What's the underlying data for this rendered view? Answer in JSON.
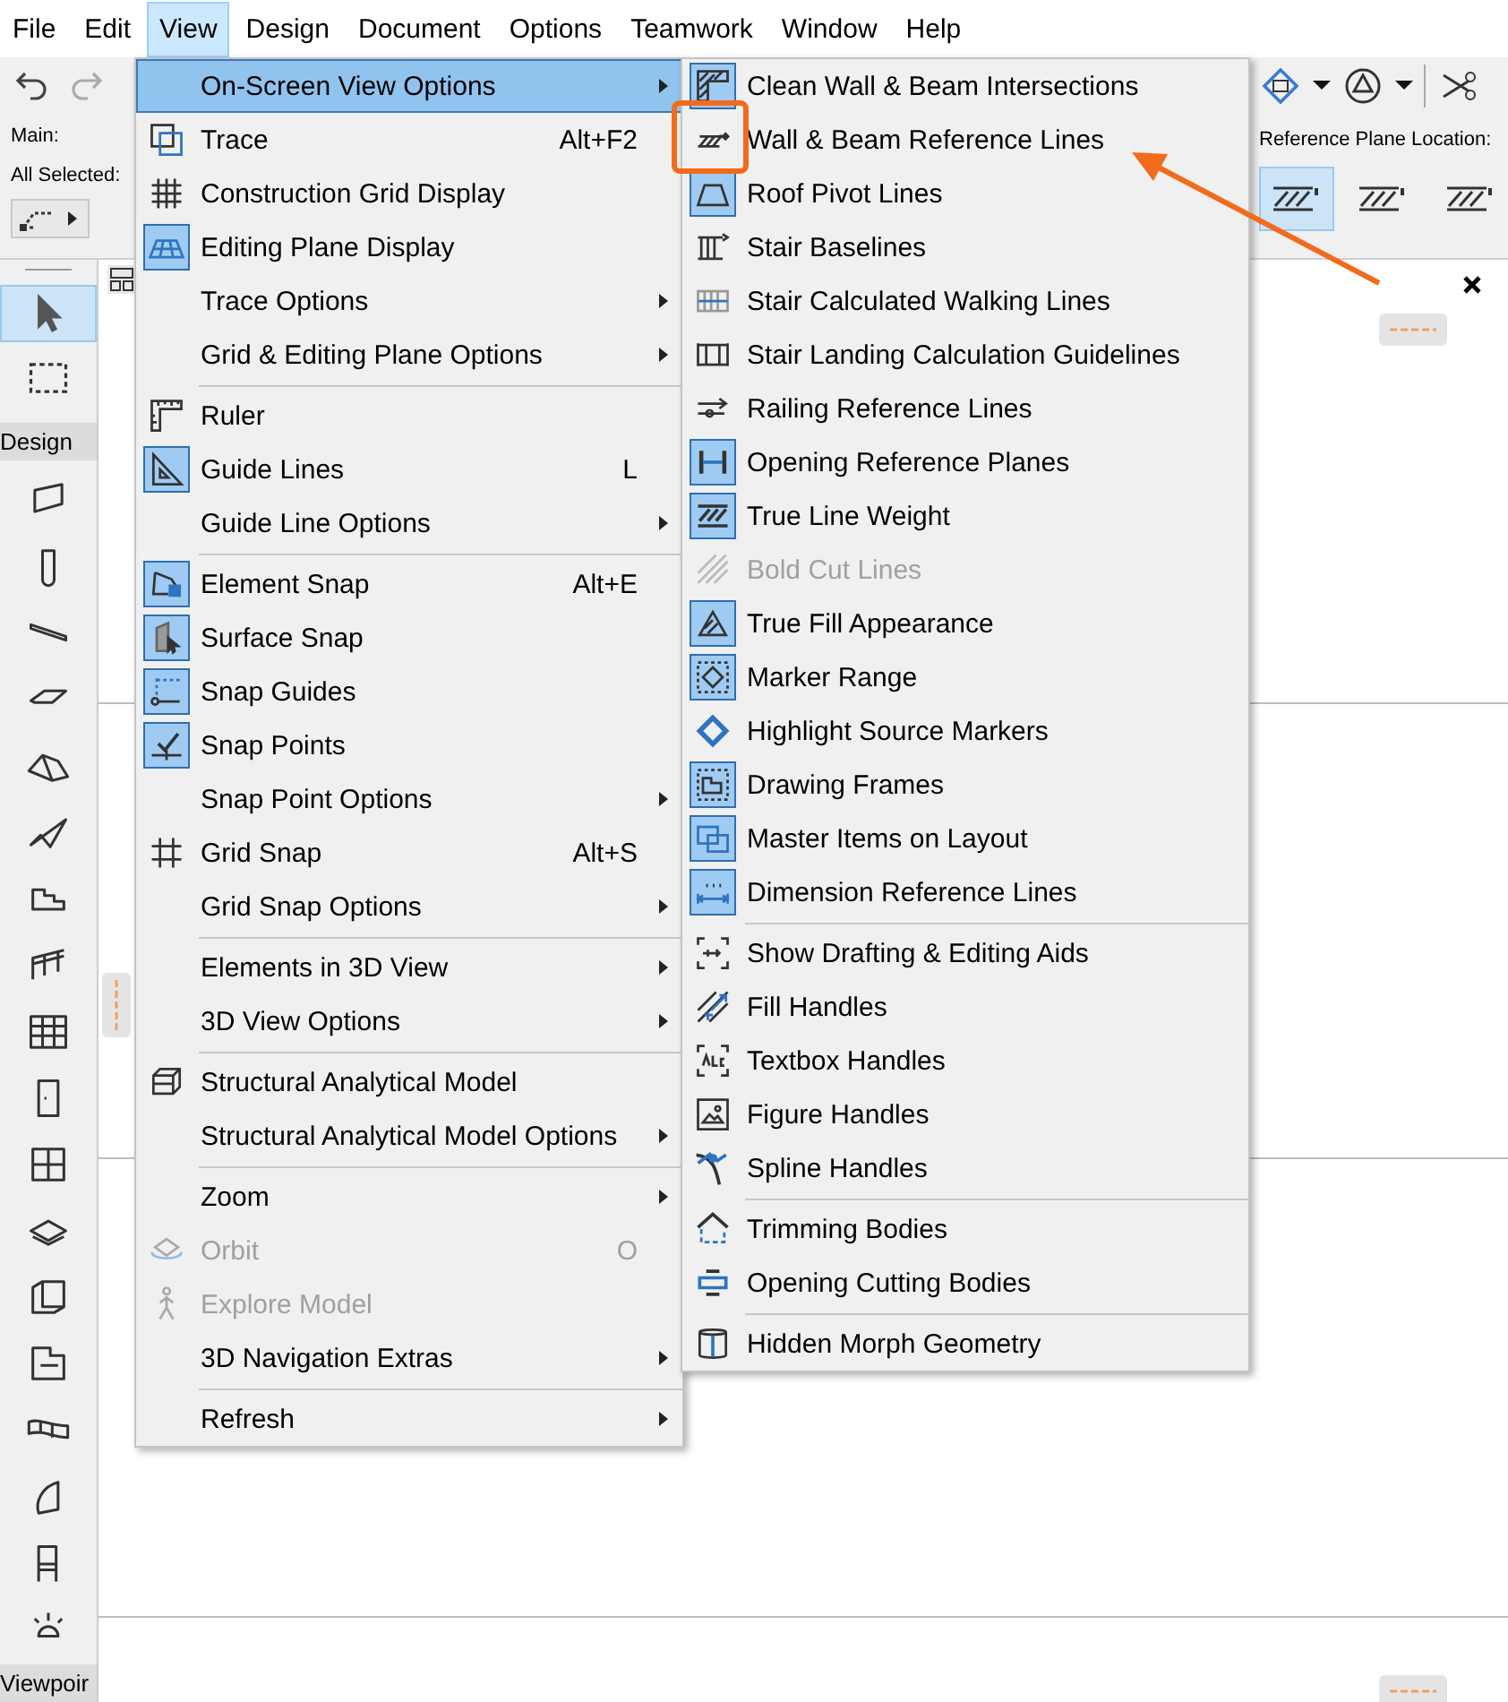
{
  "menubar": [
    {
      "label": "File",
      "selected": false
    },
    {
      "label": "Edit",
      "selected": false
    },
    {
      "label": "View",
      "selected": true
    },
    {
      "label": "Design",
      "selected": false
    },
    {
      "label": "Document",
      "selected": false
    },
    {
      "label": "Options",
      "selected": false
    },
    {
      "label": "Teamwork",
      "selected": false
    },
    {
      "label": "Window",
      "selected": false
    },
    {
      "label": "Help",
      "selected": false
    }
  ],
  "toolbar": {
    "main_label": "Main:",
    "selection_label": "All Selected:",
    "reference_plane_label": "Reference Plane Location:",
    "reference_plane_options": [
      {
        "selected": true
      },
      {
        "selected": false
      },
      {
        "selected": false
      }
    ]
  },
  "toolbox": {
    "tools": [
      {
        "selected": true
      },
      {
        "selected": false
      }
    ],
    "section": "Design",
    "design_tools": [
      {
        "selected": false
      },
      {
        "selected": false
      },
      {
        "selected": false
      },
      {
        "selected": false
      },
      {
        "selected": false
      },
      {
        "selected": false
      },
      {
        "selected": false
      },
      {
        "selected": false
      },
      {
        "selected": false
      },
      {
        "selected": false
      },
      {
        "selected": false
      },
      {
        "selected": false
      },
      {
        "selected": false
      },
      {
        "selected": false
      },
      {
        "selected": false
      },
      {
        "selected": false
      },
      {
        "selected": false
      },
      {
        "selected": false
      }
    ],
    "footer_section": "Viewpoir"
  },
  "view_menu": {
    "groups": [
      [
        {
          "label": "On-Screen View Options",
          "submenu": true,
          "checked": false,
          "disabled": false,
          "selected": true
        },
        {
          "label": "Trace",
          "shortcut": "Alt+F2",
          "submenu": false,
          "checked": false,
          "disabled": false,
          "selected": false
        },
        {
          "label": "Construction Grid Display",
          "submenu": false,
          "checked": false,
          "disabled": false,
          "selected": false
        },
        {
          "label": "Editing Plane Display",
          "submenu": false,
          "checked": true,
          "disabled": false,
          "selected": false
        },
        {
          "label": "Trace Options",
          "submenu": true,
          "checked": false,
          "disabled": false,
          "selected": false
        },
        {
          "label": "Grid & Editing Plane Options",
          "submenu": true,
          "checked": false,
          "disabled": false,
          "selected": false
        }
      ],
      [
        {
          "label": "Ruler",
          "submenu": false,
          "checked": false,
          "disabled": false,
          "selected": false
        },
        {
          "label": "Guide Lines",
          "shortcut": "L",
          "submenu": false,
          "checked": true,
          "disabled": false,
          "selected": false
        },
        {
          "label": "Guide Line Options",
          "submenu": true,
          "checked": false,
          "disabled": false,
          "selected": false
        }
      ],
      [
        {
          "label": "Element Snap",
          "shortcut": "Alt+E",
          "submenu": false,
          "checked": true,
          "disabled": false,
          "selected": false
        },
        {
          "label": "Surface Snap",
          "submenu": false,
          "checked": true,
          "disabled": false,
          "selected": false
        },
        {
          "label": "Snap Guides",
          "submenu": false,
          "checked": true,
          "disabled": false,
          "selected": false
        },
        {
          "label": "Snap Points",
          "submenu": false,
          "checked": true,
          "disabled": false,
          "selected": false
        },
        {
          "label": "Snap Point Options",
          "submenu": true,
          "checked": false,
          "disabled": false,
          "selected": false
        },
        {
          "label": "Grid Snap",
          "shortcut": "Alt+S",
          "submenu": false,
          "checked": false,
          "disabled": false,
          "selected": false
        },
        {
          "label": "Grid Snap Options",
          "submenu": true,
          "checked": false,
          "disabled": false,
          "selected": false
        }
      ],
      [
        {
          "label": "Elements in 3D View",
          "submenu": true,
          "checked": false,
          "disabled": false,
          "selected": false
        },
        {
          "label": "3D View Options",
          "submenu": true,
          "checked": false,
          "disabled": false,
          "selected": false
        }
      ],
      [
        {
          "label": "Structural Analytical Model",
          "submenu": false,
          "checked": false,
          "disabled": false,
          "selected": false
        },
        {
          "label": "Structural Analytical Model Options",
          "submenu": true,
          "checked": false,
          "disabled": false,
          "selected": false
        }
      ],
      [
        {
          "label": "Zoom",
          "submenu": true,
          "checked": false,
          "disabled": false,
          "selected": false
        },
        {
          "label": "Orbit",
          "shortcut": "O",
          "submenu": false,
          "checked": false,
          "disabled": true,
          "selected": false
        },
        {
          "label": "Explore Model",
          "submenu": false,
          "checked": false,
          "disabled": true,
          "selected": false
        },
        {
          "label": "3D Navigation Extras",
          "submenu": true,
          "checked": false,
          "disabled": false,
          "selected": false
        }
      ],
      [
        {
          "label": "Refresh",
          "submenu": true,
          "checked": false,
          "disabled": false,
          "selected": false
        }
      ]
    ]
  },
  "submenu": {
    "groups": [
      [
        {
          "label": "Clean Wall & Beam Intersections",
          "checked": true,
          "disabled": false
        },
        {
          "label": "Wall & Beam Reference Lines",
          "checked": false,
          "disabled": false
        },
        {
          "label": "Roof Pivot Lines",
          "checked": true,
          "disabled": false
        },
        {
          "label": "Stair Baselines",
          "checked": false,
          "disabled": false
        },
        {
          "label": "Stair Calculated Walking Lines",
          "checked": false,
          "disabled": false
        },
        {
          "label": "Stair Landing Calculation Guidelines",
          "checked": false,
          "disabled": false
        },
        {
          "label": "Railing Reference Lines",
          "checked": false,
          "disabled": false
        },
        {
          "label": "Opening Reference Planes",
          "checked": true,
          "disabled": false
        },
        {
          "label": "True Line Weight",
          "checked": true,
          "disabled": false
        },
        {
          "label": "Bold Cut Lines",
          "checked": false,
          "disabled": true
        },
        {
          "label": "True Fill Appearance",
          "checked": true,
          "disabled": false
        },
        {
          "label": "Marker Range",
          "checked": true,
          "disabled": false
        },
        {
          "label": "Highlight Source Markers",
          "checked": false,
          "disabled": false
        },
        {
          "label": "Drawing Frames",
          "checked": true,
          "disabled": false
        },
        {
          "label": "Master Items on Layout",
          "checked": true,
          "disabled": false
        },
        {
          "label": "Dimension Reference Lines",
          "checked": true,
          "disabled": false
        }
      ],
      [
        {
          "label": "Show Drafting & Editing Aids",
          "checked": false,
          "disabled": false
        },
        {
          "label": "Fill Handles",
          "checked": false,
          "disabled": false
        },
        {
          "label": "Textbox Handles",
          "checked": false,
          "disabled": false
        },
        {
          "label": "Figure Handles",
          "checked": false,
          "disabled": false
        },
        {
          "label": "Spline Handles",
          "checked": false,
          "disabled": false
        }
      ],
      [
        {
          "label": "Trimming Bodies",
          "checked": false,
          "disabled": false
        },
        {
          "label": "Opening Cutting Bodies",
          "checked": false,
          "disabled": false
        }
      ],
      [
        {
          "label": "Hidden Morph Geometry",
          "checked": false,
          "disabled": false
        }
      ]
    ]
  }
}
